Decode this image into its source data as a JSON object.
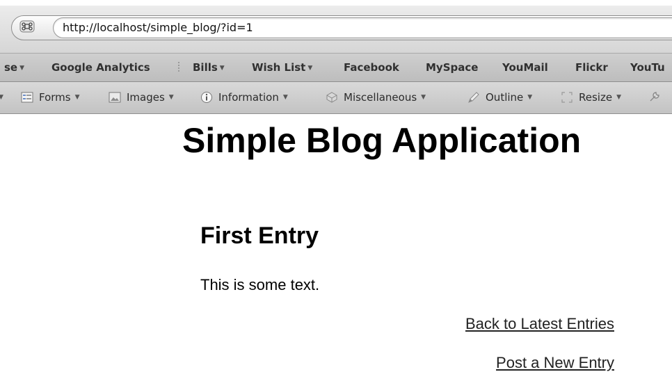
{
  "browser": {
    "url": "http://localhost/simple_blog/?id=1",
    "bookmarks": [
      {
        "label": "se",
        "dropdown": true
      },
      {
        "label": "Google Analytics",
        "dropdown": false
      },
      {
        "label": "Bills",
        "dropdown": true
      },
      {
        "label": "Wish List",
        "dropdown": true
      },
      {
        "label": "Facebook",
        "dropdown": false
      },
      {
        "label": "MySpace",
        "dropdown": false
      },
      {
        "label": "YouMail",
        "dropdown": false
      },
      {
        "label": "Flickr",
        "dropdown": false
      },
      {
        "label": "YouTu",
        "dropdown": false
      }
    ],
    "dev_toolbar": [
      {
        "label": "Forms",
        "icon": "forms-icon"
      },
      {
        "label": "Images",
        "icon": "images-icon"
      },
      {
        "label": "Information",
        "icon": "information-icon"
      },
      {
        "label": "Miscellaneous",
        "icon": "miscellaneous-icon"
      },
      {
        "label": "Outline",
        "icon": "outline-icon"
      },
      {
        "label": "Resize",
        "icon": "resize-icon"
      }
    ]
  },
  "page": {
    "title": "Simple Blog Application",
    "entry": {
      "title": "First Entry",
      "body": "This is some text."
    },
    "links": {
      "back": "Back to Latest Entries",
      "post": "Post a New Entry"
    }
  }
}
